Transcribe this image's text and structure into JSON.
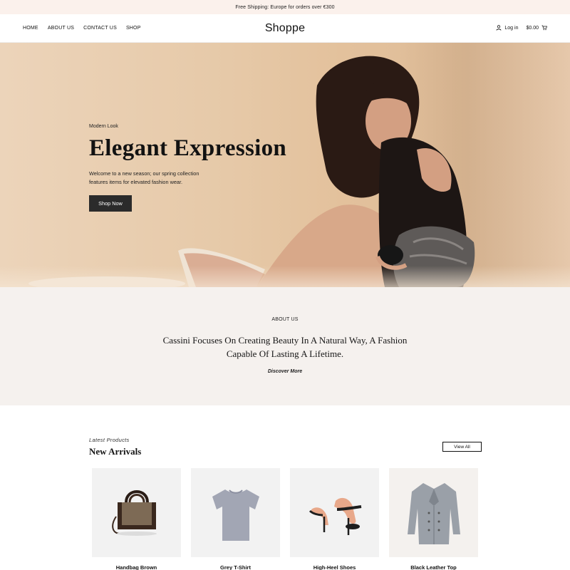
{
  "topbar": {
    "text": "Free Shipping: Europe for orders over €300"
  },
  "header": {
    "nav": [
      "HOME",
      "ABOUT US",
      "CONTACT US",
      "SHOP"
    ],
    "logo": "Shoppe",
    "login_label": "Log in",
    "cart_total": "$0.00"
  },
  "hero": {
    "kicker": "Modern Look",
    "title": "Elegant Expression",
    "description": "Welcome to a new season; our spring collection features items for elevated fashion wear.",
    "button_label": "Shop Now"
  },
  "about": {
    "label": "ABOUT US",
    "text": "Cassini Focuses On Creating Beauty In A Natural Way, A Fashion Capable Of Lasting A Lifetime.",
    "link": "Discover More"
  },
  "products": {
    "kicker": "Latest Products",
    "title": "New Arrivals",
    "view_all": "View All",
    "items": [
      {
        "name": "Handbag Brown",
        "icon": "handbag-image"
      },
      {
        "name": "Grey T-Shirt",
        "icon": "tshirt-image"
      },
      {
        "name": "High-Heel Shoes",
        "icon": "heels-image"
      },
      {
        "name": "Black Leather Top",
        "icon": "coat-image"
      }
    ]
  },
  "colors": {
    "accent_dark": "#2b2b2b",
    "topbar_bg": "#fbf1ec",
    "about_bg": "#f5f1ee"
  }
}
